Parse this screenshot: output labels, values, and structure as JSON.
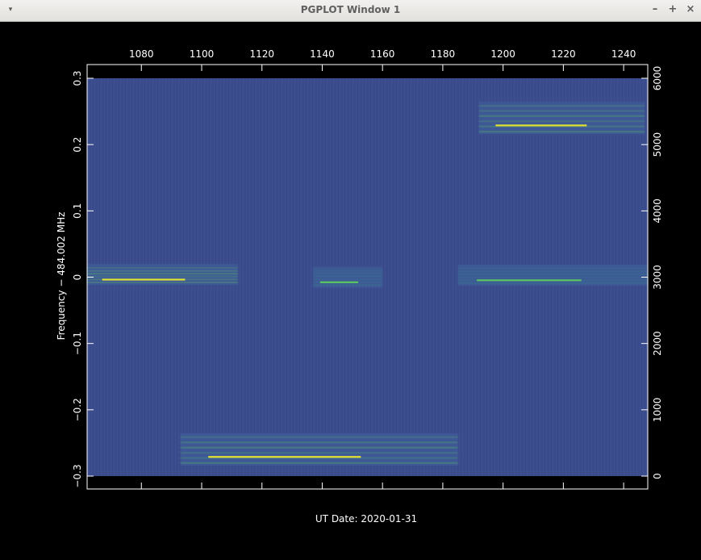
{
  "window": {
    "title": "PGPLOT Window 1"
  },
  "controls": {
    "menu": "▾",
    "minimize": "–",
    "maximize": "+",
    "close": "×"
  },
  "plot": {
    "xlabel": "UT Date: 2020-01-31",
    "ylabel": "Frequency − 484.002 MHz",
    "colors": {
      "background": "#3a4b8c",
      "low": "#3f5a96",
      "mid": "#2a8a88",
      "high": "#5fd35a",
      "peak": "#f4ee28",
      "frame": "#ffffff"
    }
  },
  "chart_data": {
    "type": "heatmap",
    "top_axis": {
      "ticks": [
        "1080",
        "1100",
        "1120",
        "1140",
        "1160",
        "1180",
        "1200",
        "1220",
        "1240"
      ],
      "range": [
        1062,
        1248
      ]
    },
    "left_axis": {
      "ticks": [
        "0.3",
        "0.2",
        "0.1",
        "0",
        "−0.1",
        "−0.2",
        "−0.3"
      ],
      "range": [
        -0.3,
        0.3
      ]
    },
    "right_axis": {
      "ticks": [
        "6000",
        "5000",
        "4000",
        "3000",
        "2000",
        "1000",
        "0"
      ],
      "range": [
        0,
        6000
      ]
    },
    "signals": [
      {
        "x_range": [
          1062,
          1112
        ],
        "y": 0.004,
        "intensity": "high"
      },
      {
        "x_range": [
          1137,
          1160
        ],
        "y": 0.0,
        "intensity": "mid"
      },
      {
        "x_range": [
          1185,
          1248
        ],
        "y": 0.003,
        "intensity": "mid"
      },
      {
        "x_range": [
          1192,
          1247
        ],
        "y": 0.24,
        "intensity": "high"
      },
      {
        "x_range": [
          1093,
          1185
        ],
        "y": -0.26,
        "intensity": "high"
      }
    ]
  }
}
